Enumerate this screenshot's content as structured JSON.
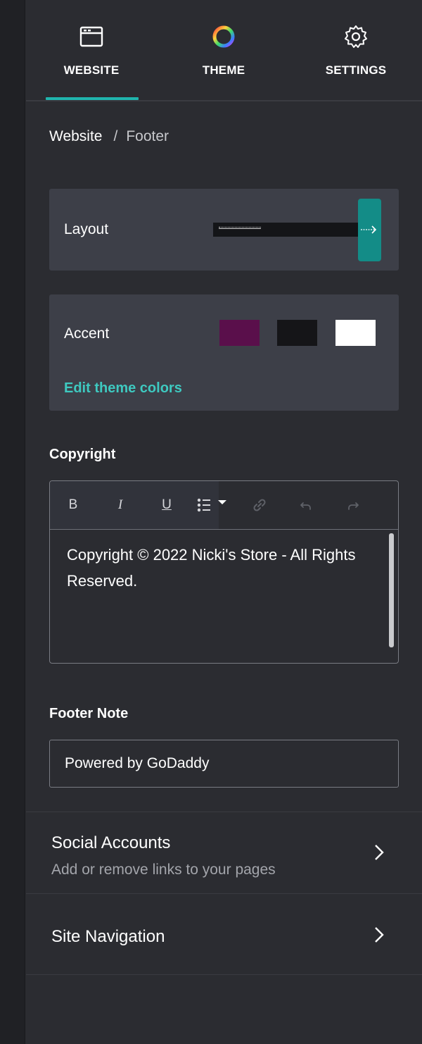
{
  "tabs": [
    {
      "label": "WEBSITE",
      "icon": "browser-window-icon",
      "active": true
    },
    {
      "label": "THEME",
      "icon": "color-wheel-icon",
      "active": false
    },
    {
      "label": "SETTINGS",
      "icon": "gear-icon",
      "active": false
    }
  ],
  "breadcrumb": {
    "root": "Website",
    "separator": "/",
    "current": "Footer"
  },
  "layout": {
    "label": "Layout"
  },
  "accent": {
    "label": "Accent",
    "swatches": [
      "#5a0f4b",
      "#151518",
      "#ffffff"
    ],
    "edit_link": "Edit theme colors"
  },
  "copyright": {
    "label": "Copyright",
    "toolbar": [
      "B",
      "I",
      "U",
      "list",
      "link",
      "undo",
      "redo"
    ],
    "text": "Copyright © 2022 Nicki's Store - All Rights Reserved."
  },
  "footer_note": {
    "label": "Footer Note",
    "value": "Powered by GoDaddy"
  },
  "nav": {
    "social": {
      "title": "Social Accounts",
      "subtitle": "Add or remove links to your pages"
    },
    "site": {
      "title": "Site Navigation"
    }
  },
  "colors": {
    "accent_teal": "#1fb5ad",
    "link_teal": "#3ec9c0",
    "panel_bg": "#2b2c31",
    "card_bg": "#3d3f48"
  }
}
